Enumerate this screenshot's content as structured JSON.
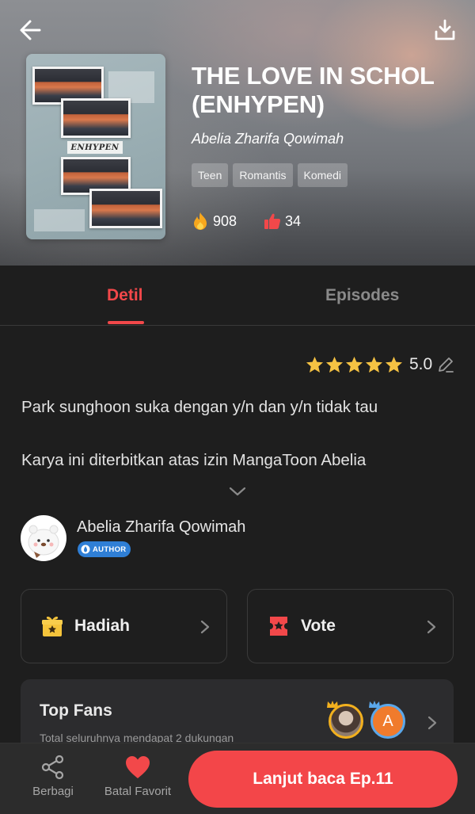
{
  "header": {
    "back_icon": "arrow-left-icon",
    "download_icon": "download-icon"
  },
  "book": {
    "title": "THE LOVE IN SCHOL (ENHYPEN)",
    "author": "Abelia Zharifa Qowimah",
    "cover_band_text": "ENHYPEN",
    "tags": [
      "Teen",
      "Romantis",
      "Komedi"
    ],
    "views": "908",
    "likes": "34",
    "views_icon": "fire-icon",
    "likes_icon": "thumbs-up-icon"
  },
  "tabs": [
    {
      "label": "Detil",
      "active": true
    },
    {
      "label": "Episodes",
      "active": false
    }
  ],
  "rating": {
    "stars": 5,
    "value": "5.0"
  },
  "description": {
    "line1": "Park sunghoon suka dengan y/n dan y/n tidak tau",
    "line2": "Karya ini diterbitkan atas izin MangaToon Abelia"
  },
  "author": {
    "name": "Abelia Zharifa Qowimah",
    "badge": "AUTHOR"
  },
  "actions": {
    "gift_label": "Hadiah",
    "vote_label": "Vote"
  },
  "fans": {
    "title": "Top Fans",
    "subtitle": "Total seluruhnya mendapat 2 dukungan",
    "avatar2_letter": "A"
  },
  "bottom_bar": {
    "share_label": "Berbagi",
    "favorite_label": "Batal Favorit",
    "read_button": "Lanjut baca Ep.11"
  },
  "colors": {
    "accent": "#f34649",
    "background": "#1e1e1e",
    "star": "#f5c243"
  }
}
